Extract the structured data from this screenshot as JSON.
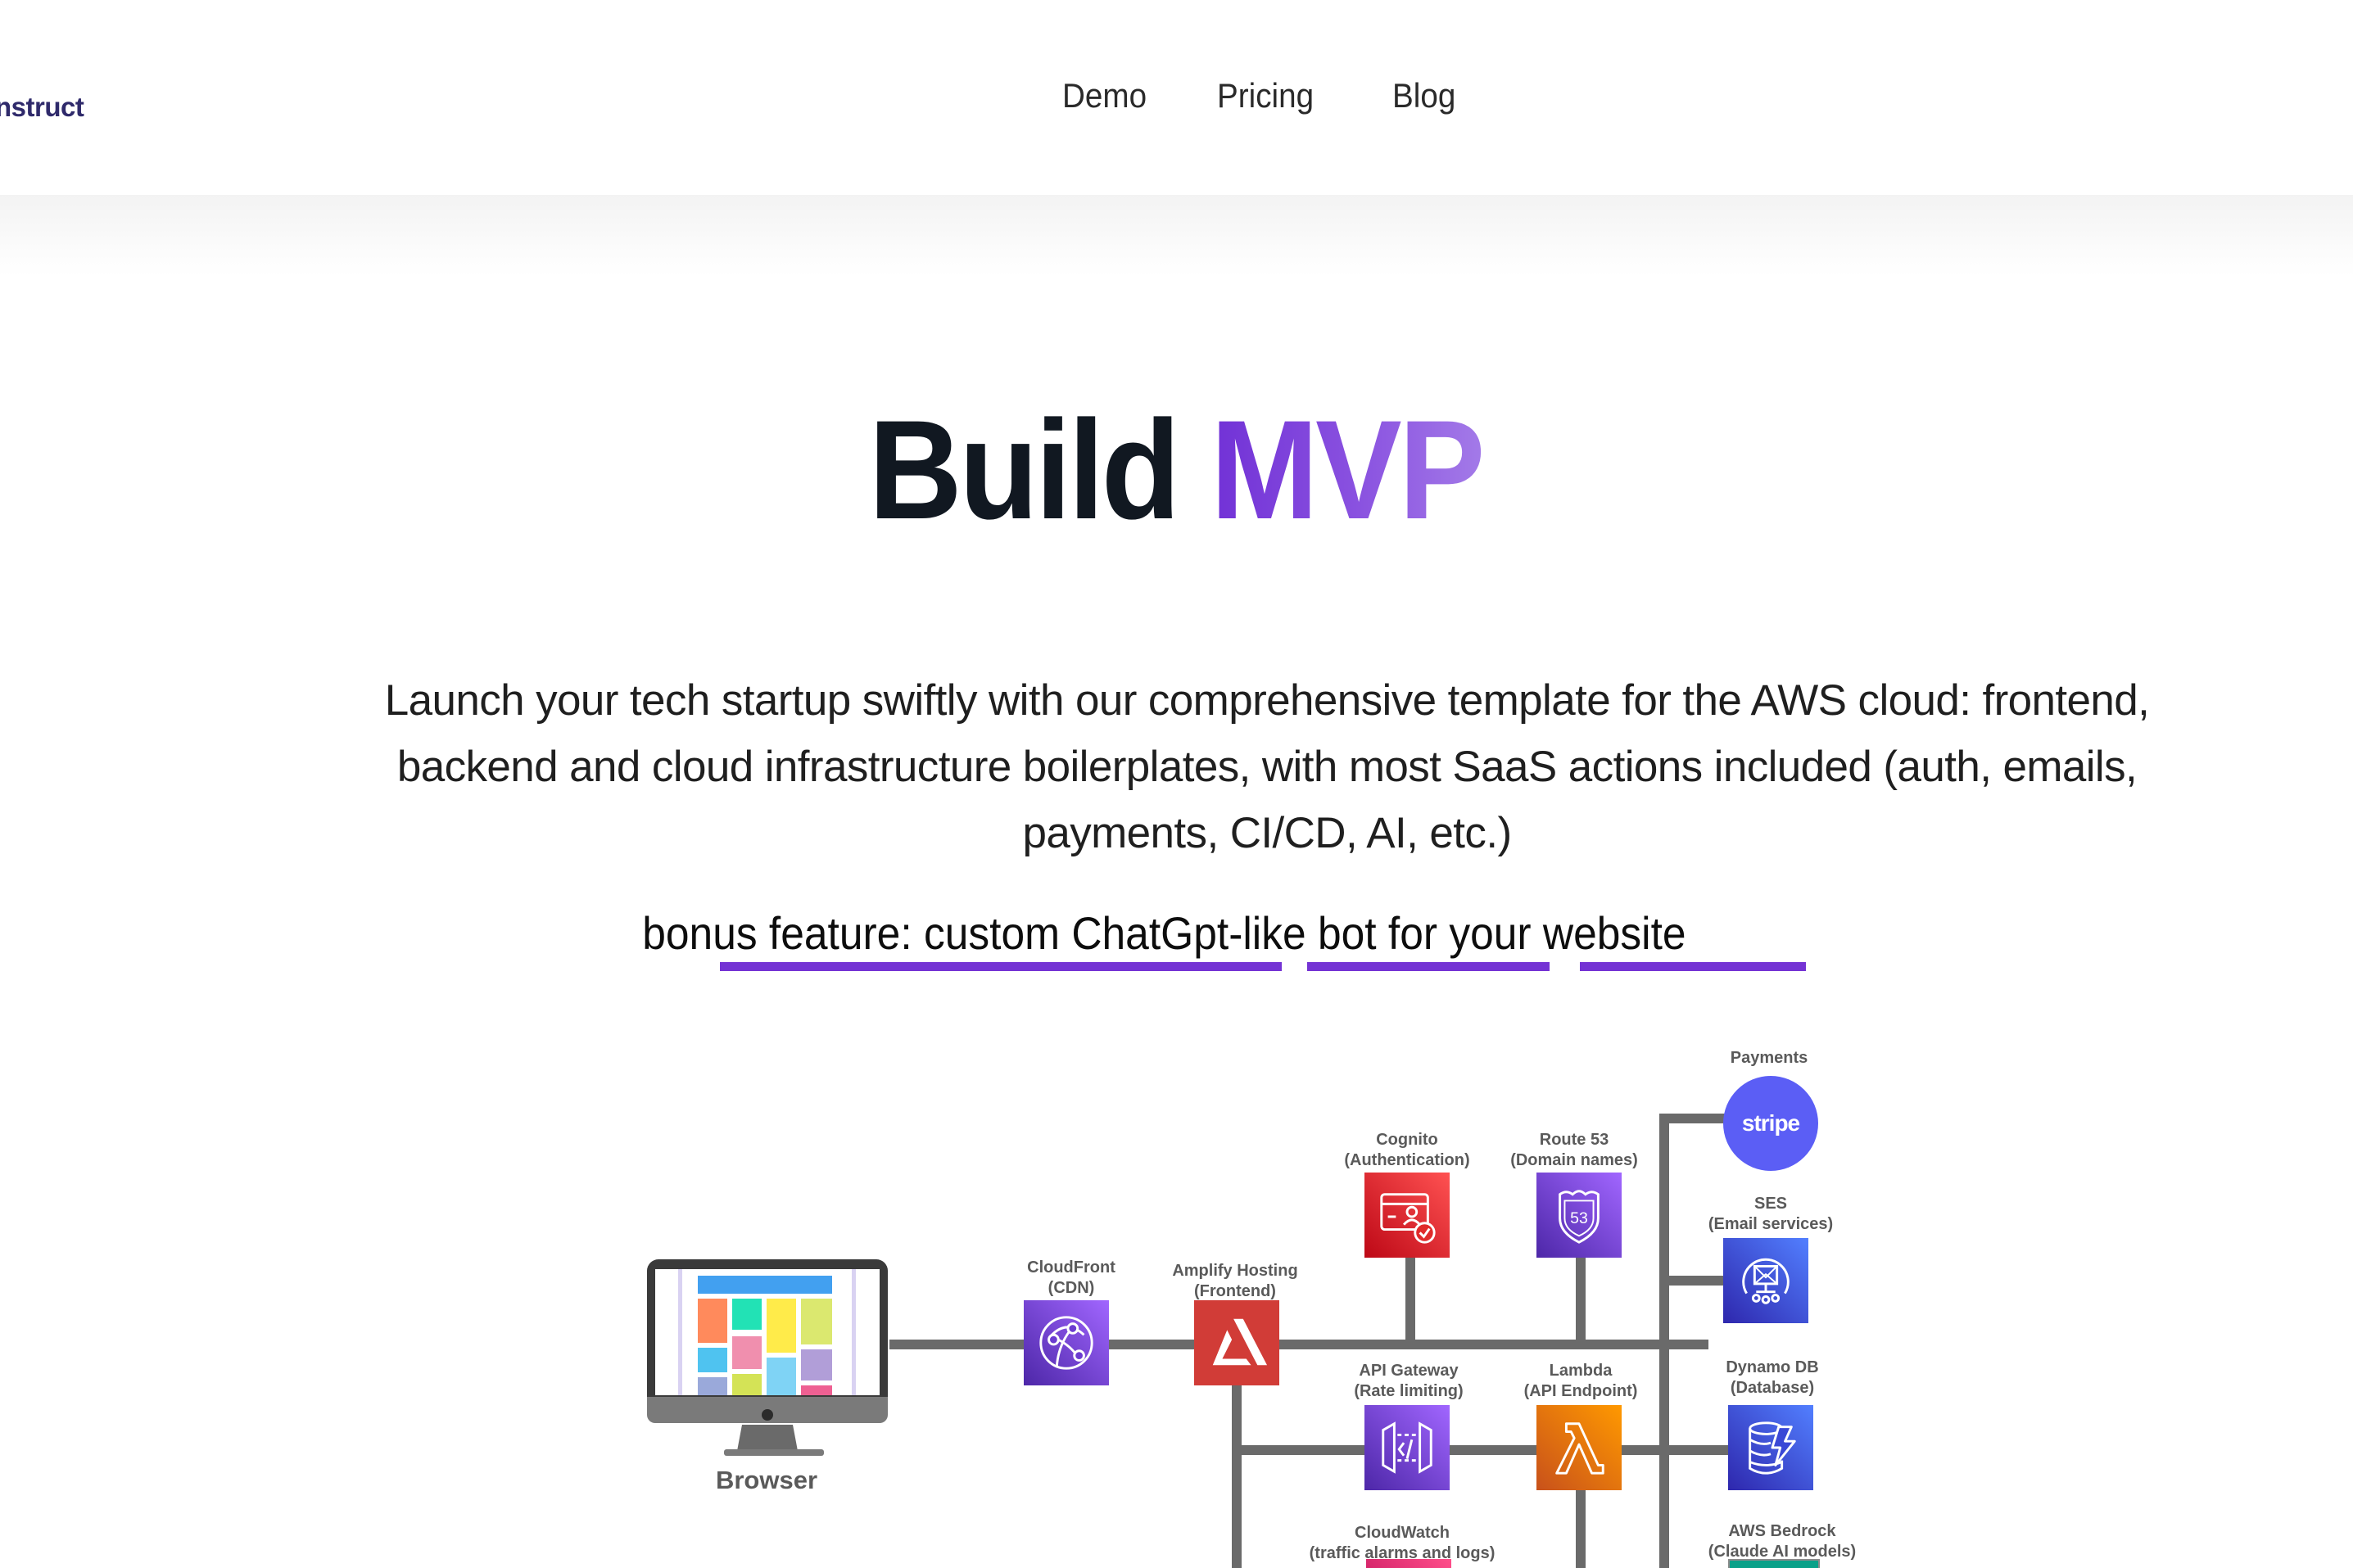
{
  "header": {
    "logo_text": "nstruct",
    "nav": [
      {
        "label": "Demo"
      },
      {
        "label": "Pricing"
      },
      {
        "label": "Blog"
      }
    ]
  },
  "hero": {
    "title_part1": "Build",
    "title_part2": "MVP",
    "description": "Launch your tech startup swiftly with our comprehensive template for the AWS cloud: frontend, backend and cloud infrastructure boilerplates, with most SaaS actions included (auth, emails, payments, CI/CD, AI, etc.)",
    "bonus_text": "bonus feature: custom ChatGpt-like bot for your website",
    "accent_color": "#7433d4"
  },
  "diagram": {
    "browser": {
      "label": "Browser"
    },
    "nodes": {
      "cloudfront": {
        "name": "CloudFront",
        "role": "(CDN)"
      },
      "amplify": {
        "name": "Amplify Hosting",
        "role": "(Frontend)"
      },
      "cognito": {
        "name": "Cognito",
        "role": "(Authentication)"
      },
      "route53": {
        "name": "Route 53",
        "role": "(Domain names)",
        "badge": "53"
      },
      "stripe": {
        "name": "Payments",
        "logo": "stripe"
      },
      "ses": {
        "name": "SES",
        "role": "(Email services)"
      },
      "apigateway": {
        "name": "API Gateway",
        "role": "(Rate limiting)"
      },
      "lambda": {
        "name": "Lambda",
        "role": "(API Endpoint)"
      },
      "dynamodb": {
        "name": "Dynamo DB",
        "role": "(Database)"
      },
      "cloudwatch": {
        "name": "CloudWatch",
        "role": "(traffic alarms and logs)"
      },
      "bedrock": {
        "name": "AWS Bedrock",
        "role": "(Claude AI models)"
      }
    }
  }
}
